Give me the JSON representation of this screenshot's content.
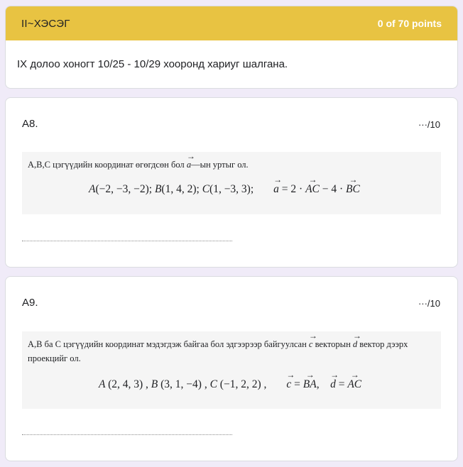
{
  "section": {
    "title": "II~ХЭСЭГ",
    "points": "0 of 70 points",
    "description": "IX долоо хоногт 10/25 - 10/29 хооронд хариуг шалгана.",
    "header_color": "#e8c342"
  },
  "questions": [
    {
      "title": "A8.",
      "score": "···/10",
      "prompt": "A,B,C цэгүүдийн координат өгөгдсөн бол a—ын уртыг ол.",
      "formula": "A(−2, −3, −2); B(1, 4, 2); C(1, −3, 3);    a = 2 · AC − 4 · BC"
    },
    {
      "title": "A9.",
      "score": "···/10",
      "prompt": "A,B ба C цэгүүдийн координат мэдэгдэж байгаа бол эдгээрээр байгуулсан c векторын d вектор дээрх проекцийг ол.",
      "formula": "A (2, 4, 3) , B (3, 1, −4) , C (−1, 2, 2) ,    c = BA,    d = AC"
    }
  ]
}
